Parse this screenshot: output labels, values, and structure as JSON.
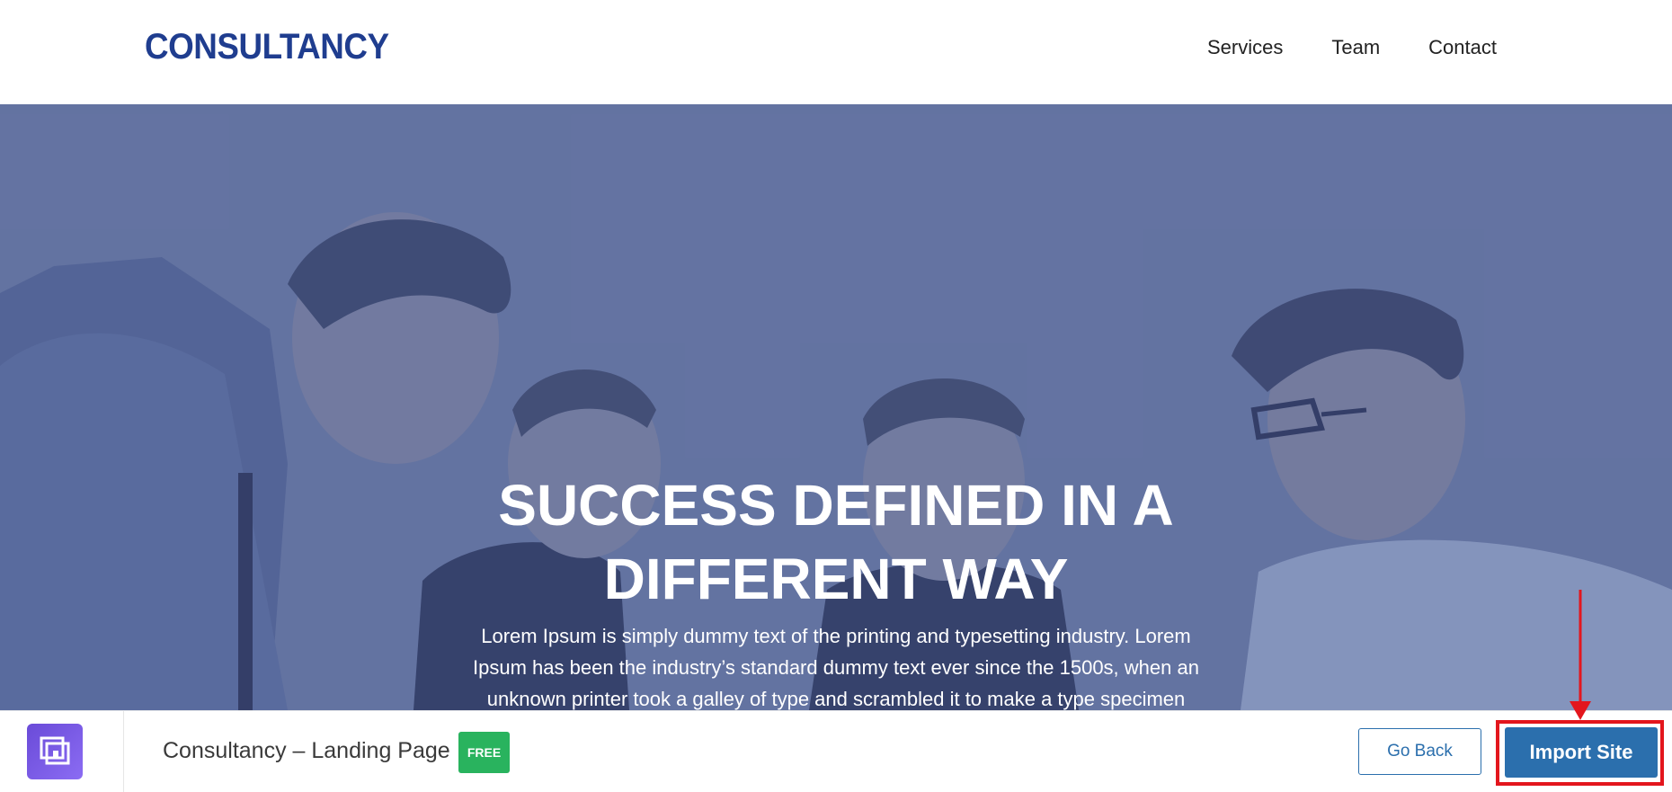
{
  "header": {
    "logo": "CONSULTANCY",
    "nav": [
      "Services",
      "Team",
      "Contact"
    ]
  },
  "hero": {
    "title": "SUCCESS DEFINED IN A\nDIFFERENT WAY",
    "text": "Lorem Ipsum is simply dummy text of the printing and typesetting industry. Lorem Ipsum has been the industry’s standard dummy text ever since the 1500s, when an unknown printer took a galley of type and scrambled it to make a type specimen book."
  },
  "bottom_bar": {
    "app_icon": "site-builder-icon",
    "site_name": "Consultancy – Landing Page",
    "badge": "FREE",
    "go_back": "Go Back",
    "import": "Import Site"
  },
  "annotation": {
    "arrow_color": "#e3161d"
  },
  "colors": {
    "brand": "#1f3d8f",
    "button": "#2b6fad",
    "badge": "#29b35e",
    "hero_overlay": "#7380a7"
  }
}
